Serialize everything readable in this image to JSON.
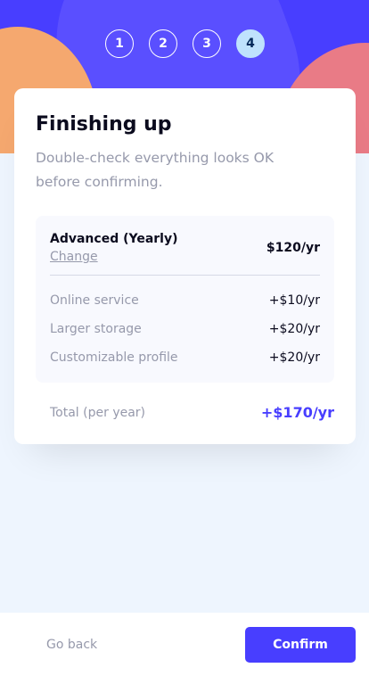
{
  "steps": [
    "1",
    "2",
    "3",
    "4"
  ],
  "active_step": 4,
  "colors": {
    "accent": "#483eff",
    "active_step": "#bfe2fd",
    "page_bg": "#eef5fe"
  },
  "card": {
    "title": "Finishing up",
    "subtitle": "Double-check everything looks OK before confirming."
  },
  "summary": {
    "plan_name": "Advanced (Yearly)",
    "change_label": "Change",
    "plan_price": "$120/yr",
    "addons": [
      {
        "name": "Online service",
        "price": "+$10/yr"
      },
      {
        "name": "Larger storage",
        "price": "+$20/yr"
      },
      {
        "name": "Customizable profile",
        "price": "+$20/yr"
      }
    ]
  },
  "total": {
    "label": "Total (per year)",
    "price": "+$170/yr"
  },
  "footer": {
    "back_label": "Go back",
    "confirm_label": "Confirm"
  }
}
